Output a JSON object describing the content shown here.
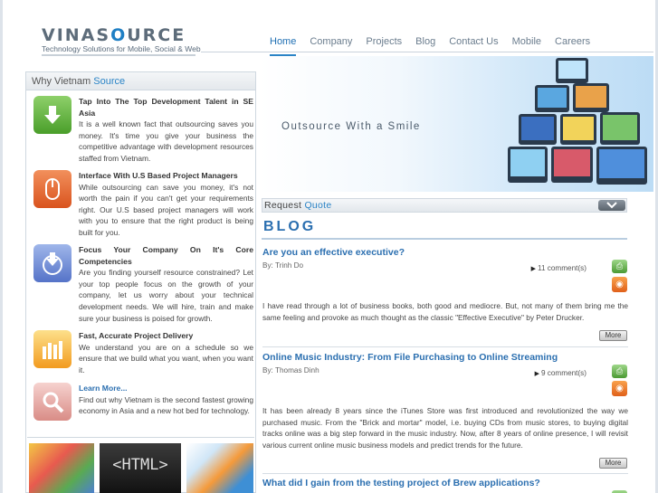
{
  "brand": {
    "name_prefix": "VINAS",
    "name_o": "O",
    "name_suffix": "URCE",
    "tagline": "Technology Solutions for Mobile, Social & Web"
  },
  "nav": {
    "items": [
      {
        "label": "Home",
        "active": true
      },
      {
        "label": "Company",
        "active": false
      },
      {
        "label": "Projects",
        "active": false
      },
      {
        "label": "Blog",
        "active": false
      },
      {
        "label": "Contact Us",
        "active": false
      },
      {
        "label": "Mobile",
        "active": false
      },
      {
        "label": "Careers",
        "active": false
      }
    ]
  },
  "why": {
    "heading_prefix": "Why Vietnam ",
    "heading_accent": "Source",
    "features": [
      {
        "icon": "download-arrow-icon",
        "title": "Tap Into The Top Development Talent in SE Asia",
        "text": "It is a well known fact that outsourcing saves you money. It's time you give your business the competitive advantage with development resources staffed from Vietnam."
      },
      {
        "icon": "mouse-icon",
        "title": "Interface With U.S Based Project Managers",
        "text": "While outsourcing can save you money, it's not worth the pain if you can't get your requirements right. Our U.S based project managers will work with you to ensure that the right product is being built for you."
      },
      {
        "icon": "target-download-icon",
        "title": "Focus Your Company On It's Core Competencies",
        "text": "Are you finding yourself resource constrained? Let your top people focus on the growth of your company, let us worry about your technical development needs. We will hire, train and make sure your business is poised for growth."
      },
      {
        "icon": "bar-chart-icon",
        "title": "Fast, Accurate Project Delivery",
        "text": "We understand you are on a schedule so we ensure that we build what you want, when you want it."
      },
      {
        "icon": "magnifier-icon",
        "title": "Learn More...",
        "text": "Find out why Vietnam is the second fastest growing economy in Asia and a new hot bed for technology."
      }
    ]
  },
  "app_strip": {
    "mid_text": "<HTML>"
  },
  "hero": {
    "tagline": "Outsource With a Smile"
  },
  "quote": {
    "prefix": "Request ",
    "accent": "Quote",
    "button_icon": "chevron-down-icon"
  },
  "blog": {
    "heading": "BLOG",
    "posts": [
      {
        "title": "Are you an effective executive?",
        "author": "By: Trinh Do",
        "comments": "11 comment(s)",
        "body": "I have read through a lot of business books, both good and mediocre. But, not many of them bring me the same feeling and provoke as much thought as the classic \"Effective Executive\" by Peter Drucker.",
        "more": "More"
      },
      {
        "title": "Online Music Industry: From File Purchasing to Online Streaming",
        "author": "By: Thomas Dinh",
        "comments": "9 comment(s)",
        "body": "It has been already 8 years since the iTunes Store was first introduced and revolutionized the way we purchased music. From the \"Brick and mortar\" model, i.e. buying CDs from music stores, to buying digital tracks online was a big step forward in the music industry. Now, after 8 years of online presence, I will revisit various current online music business models and predict trends for the future.",
        "more": "More"
      },
      {
        "title": "What did I gain from the testing project of Brew applications?",
        "author": "",
        "comments": "",
        "body": "",
        "more": ""
      }
    ]
  },
  "colors": {
    "accent": "#2b84c6",
    "link": "#2b6fb0"
  }
}
